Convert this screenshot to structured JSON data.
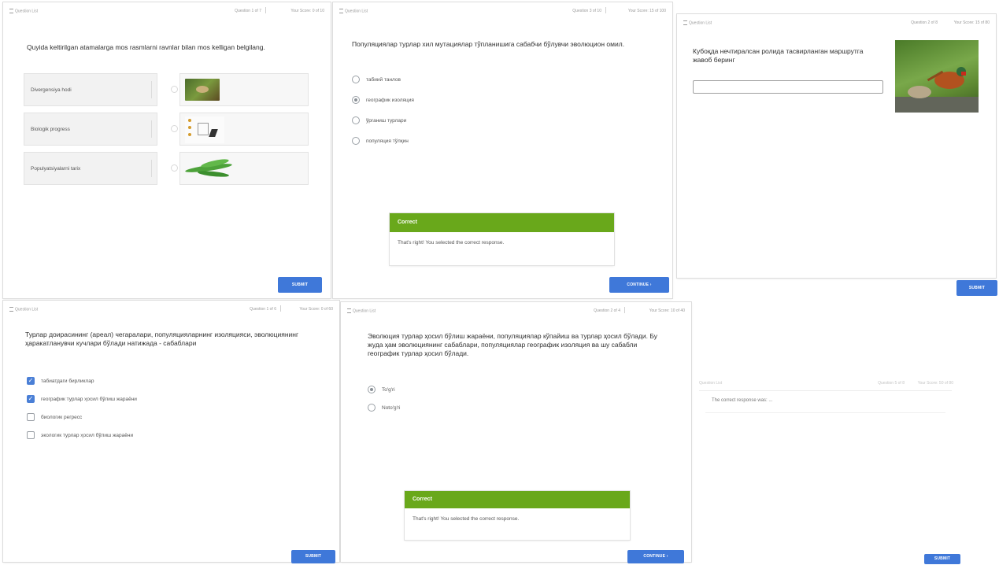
{
  "colors": {
    "accent": "#3f78d9",
    "correct": "#69a81b"
  },
  "panels": {
    "p1": {
      "header": {
        "question_list": "Question List",
        "question_count": "Question 1 of 7",
        "score": "Your Score: 0 of 10"
      },
      "question": "Quyida keltirilgan atamalarga mos rasmlarni ravnlar bilan mos kelligan belgilang.",
      "items": [
        "Divergensiya hodi",
        "Biologik progress",
        "Populyatsiyalarni tarix"
      ],
      "images": [
        "bird-photo",
        "stages-icon",
        "leaves-photo"
      ],
      "submit_label": "SUBMIT"
    },
    "p2": {
      "header": {
        "question_list": "Question List",
        "question_count": "Question 3 of 10",
        "score": "Your Score: 15 of 100"
      },
      "question": "Популяциялар турлар хил мутациялар тўпланишига сабабчи бўлувчи эволюцион омил.",
      "options": [
        "табиий танлов",
        "географик изоляция",
        "ўрганиш турлари",
        "популяция тўлқин"
      ],
      "selected": 1,
      "feedback": {
        "title": "Correct",
        "text": "That's right! You selected the correct response."
      },
      "continue_label": "CONTINUE"
    },
    "p3": {
      "header": {
        "question_list": "Question List",
        "question_count": "Question 2 of 8",
        "score": "Your Score: 15 of 80"
      },
      "question": "Кубоқда нечтиралсан ролида тасвирланган маршрутга жавоб беринг",
      "input_value": "",
      "photo": "pheasant-photo",
      "submit_label": "SUBMIT"
    },
    "p4": {
      "header": {
        "question_list": "Question List",
        "question_count": "Question 1 of 6",
        "score": "Your Score: 0 of 60"
      },
      "question": "Турлар доирасининг (ареал) чегаралари, популяцияларнинг изоляцияси, эволюциянинг ҳаракатланувчи кучлари бўлади натижада - сабаблари",
      "options": [
        "табиатдаги бирликлар",
        "географик турлар ҳосил бўлиш жараёни",
        "биологик регресс",
        "экологик турлар ҳосил бўлиш жараёни"
      ],
      "checked": [
        true,
        true,
        false,
        false
      ],
      "submit_label": "SUBMIT"
    },
    "p5": {
      "header": {
        "question_list": "Question List",
        "question_count": "Question 2 of 4",
        "score": "Your Score: 10 of 40"
      },
      "question": "Эволюция турлар ҳосил бўлиш жараёни, популяциялар кўпайиш ва турлар ҳосил бўлади. Бу жуда ҳам эволюциянинг сабаблари, популяциялар географик изоляция ва шу сабабли географик турлар ҳосил бўлади.",
      "options": [
        "To'g'ri",
        "Noto'g'ri"
      ],
      "selected": 0,
      "feedback": {
        "title": "Correct",
        "text": "That's right! You selected the correct response."
      },
      "continue_label": "CONTINUE"
    },
    "p6": {
      "header": {
        "question_list": "Question List",
        "question_count": "Question 5 of 8",
        "score": "Your Score: 50 of 80"
      },
      "text": "The correct response was: ...",
      "submit_label": "SUBMIT"
    }
  }
}
